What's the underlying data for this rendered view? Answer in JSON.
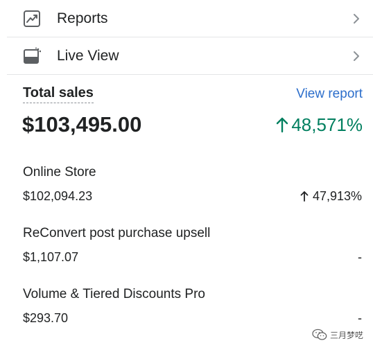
{
  "nav": {
    "items": [
      {
        "label": "Reports",
        "icon": "reports-chart-icon"
      },
      {
        "label": "Live View",
        "icon": "live-view-icon"
      }
    ]
  },
  "total_sales": {
    "title": "Total sales",
    "view_report_label": "View report",
    "value": "$103,495.00",
    "change": "48,571%",
    "change_color": "#007f5f"
  },
  "channels": [
    {
      "name": "Online Store",
      "amount": "$102,094.23",
      "change": "47,913%"
    },
    {
      "name": "ReConvert post purchase upsell",
      "amount": "$1,107.07",
      "change": "-"
    },
    {
      "name": "Volume & Tiered Discounts Pro",
      "amount": "$293.70",
      "change": "-"
    }
  ],
  "watermark": {
    "text": "三月梦呓",
    "icon": "wechat-icon"
  },
  "colors": {
    "link": "#2c6ecb",
    "positive": "#007f5f",
    "text": "#202223",
    "divider": "#e4e5e7"
  }
}
